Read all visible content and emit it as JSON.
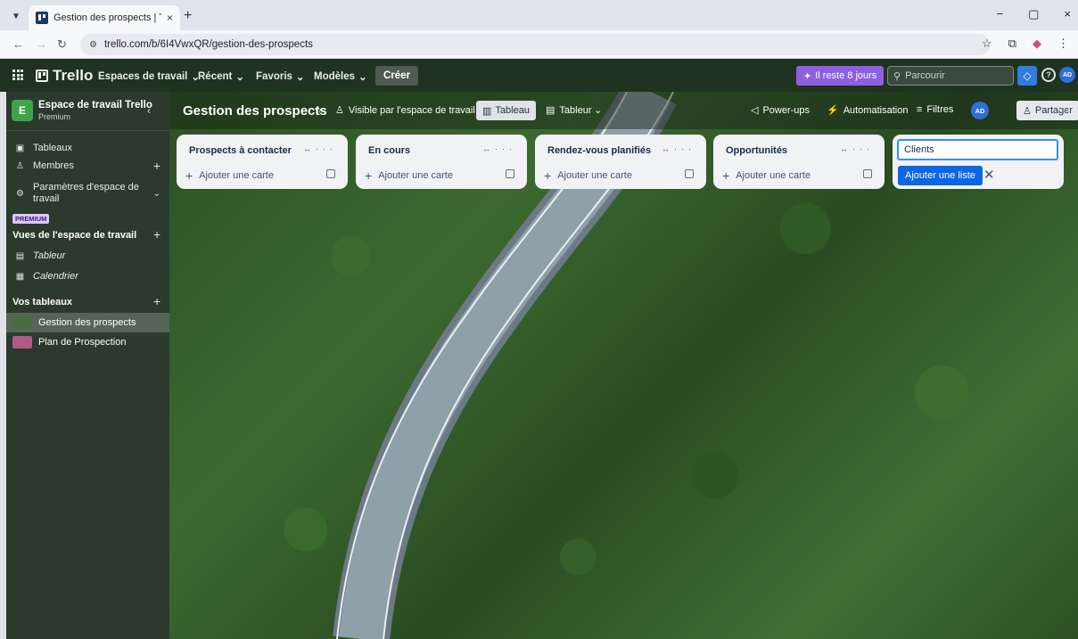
{
  "browser": {
    "tab_title": "Gestion des prospects | Trello",
    "tab_close": "×",
    "new_tab": "+",
    "url": "trello.com/b/6I4VwxQR/gestion-des-prospects",
    "window_controls": [
      "−",
      "▢",
      "×"
    ]
  },
  "header": {
    "logo_text": "Trello",
    "menus": [
      "Espaces de travail",
      "Récent",
      "Favoris",
      "Modèles"
    ],
    "create_label": "Créer",
    "trial_label": "Il reste 8 jours",
    "search_placeholder": "Parcourir",
    "avatar_initials": "AD",
    "help_glyph": "?"
  },
  "sidebar": {
    "workspace_initial": "E",
    "workspace_name": "Espace de travail Trello",
    "workspace_plan": "Premium",
    "items": [
      {
        "label": "Tableaux",
        "icon": "board-icon"
      },
      {
        "label": "Membres",
        "icon": "members-icon"
      },
      {
        "label": "Paramètres d'espace de travail",
        "icon": "gear-icon"
      }
    ],
    "premium_tag": "PREMIUM",
    "views_title": "Vues de l'espace de travail",
    "views": [
      {
        "label": "Tableur",
        "icon": "table-icon"
      },
      {
        "label": "Calendrier",
        "icon": "calendar-icon"
      }
    ],
    "boards_title": "Vos tableaux",
    "boards": [
      {
        "label": "Gestion des prospects",
        "color": "#4a6b3f",
        "active": true
      },
      {
        "label": "Plan de Prospection",
        "color": "#b05a8a",
        "active": false
      }
    ]
  },
  "board": {
    "title": "Gestion des prospects",
    "visibility": "Visible par l'espace de travail",
    "view_active": "Tableau",
    "view_other": "Tableur",
    "powerups": "Power-ups",
    "automation": "Automatisation",
    "filters": "Filtres",
    "member_initials": "AD",
    "share": "Partager",
    "more": "···"
  },
  "lists": [
    {
      "title": "Prospects à contacter",
      "add_card": "Ajouter une carte"
    },
    {
      "title": "En cours",
      "add_card": "Ajouter une carte"
    },
    {
      "title": "Rendez-vous planifiés",
      "add_card": "Ajouter une carte"
    },
    {
      "title": "Opportunités",
      "add_card": "Ajouter une carte"
    }
  ],
  "new_list": {
    "input_value": "Clients",
    "add_button": "Ajouter une liste",
    "cancel": "✕"
  },
  "colors": {
    "header_bg": "#1f3320",
    "sidebar_bg": "#2b3a2c",
    "accent_blue": "#0c66e4",
    "trial_purple": "#8f5fe0",
    "workspace_badge": "#3fa34d"
  }
}
